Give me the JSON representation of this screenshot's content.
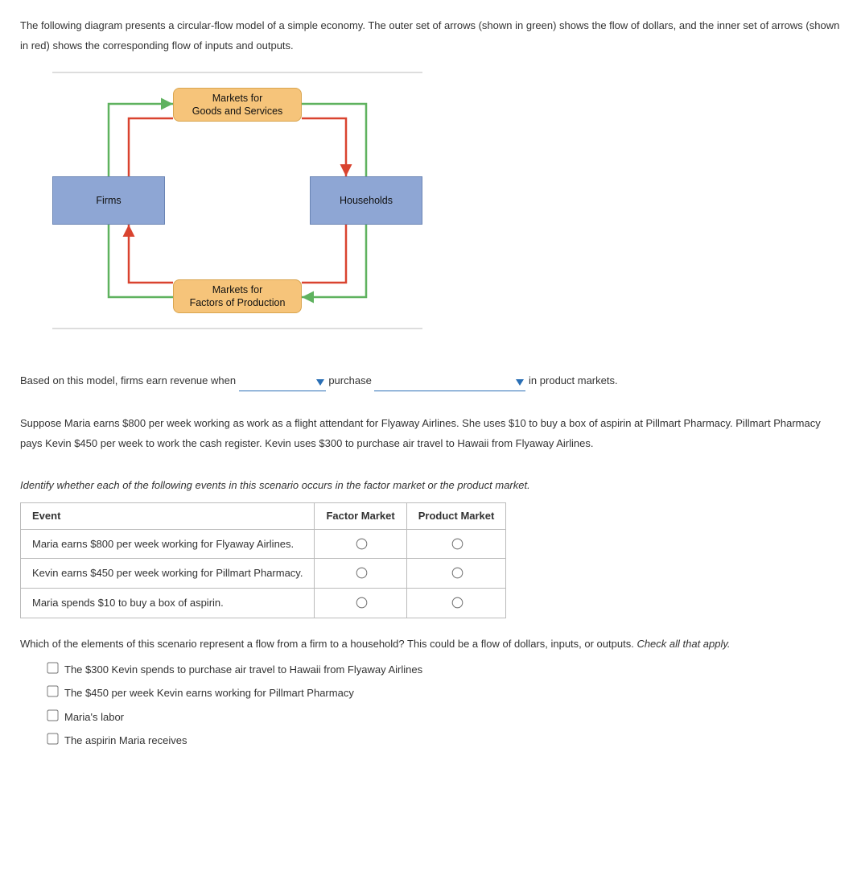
{
  "intro": "The following diagram presents a circular-flow model of a simple economy. The outer set of arrows (shown in green) shows the flow of dollars, and the inner set of arrows (shown in red) shows the corresponding flow of inputs and outputs.",
  "diagram": {
    "firms": "Firms",
    "households": "Households",
    "markets_goods": "Markets for\nGoods and Services",
    "markets_factors": "Markets for\nFactors of Production"
  },
  "sentence": {
    "pre": "Based on this model, firms earn revenue when ",
    "mid": " purchase ",
    "post": " in product markets."
  },
  "scenario": "Suppose Maria earns $800 per week working as work as a flight attendant for Flyaway Airlines. She uses $10 to buy a box of aspirin at Pillmart Pharmacy. Pillmart Pharmacy pays Kevin $450 per week to work the cash register. Kevin uses $300 to purchase air travel to Hawaii from Flyaway Airlines.",
  "table_prompt": "Identify whether each of the following events in this scenario occurs in the factor market or the product market.",
  "table": {
    "headers": [
      "Event",
      "Factor Market",
      "Product Market"
    ],
    "rows": [
      "Maria earns $800 per week working for Flyaway Airlines.",
      "Kevin earns $450 per week working for Pillmart Pharmacy.",
      "Maria spends $10 to buy a box of aspirin."
    ]
  },
  "check_prompt_a": "Which of the elements of this scenario represent a flow from a firm to a household? This could be a flow of dollars, inputs, or outputs. ",
  "check_prompt_b": "Check all that apply.",
  "checks": [
    "The $300 Kevin spends to purchase air travel to Hawaii from Flyaway Airlines",
    "The $450 per week Kevin earns working for Pillmart Pharmacy",
    "Maria's labor",
    "The aspirin Maria receives"
  ]
}
